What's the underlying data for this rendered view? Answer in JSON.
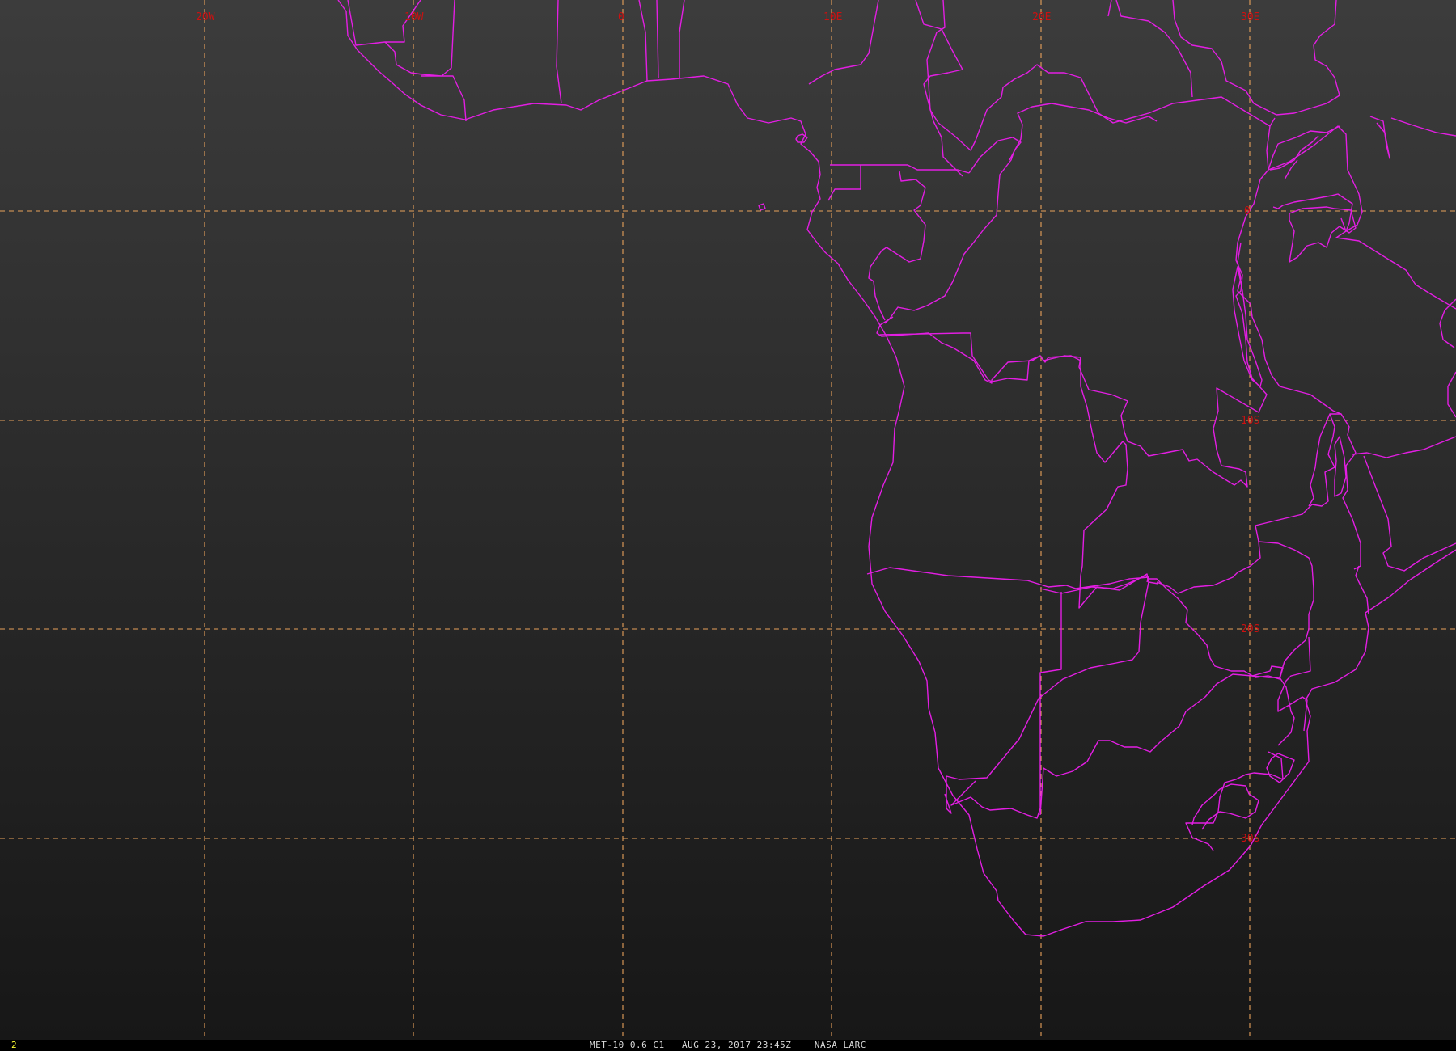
{
  "map": {
    "background_colors": {
      "top": "#3c3c3c",
      "bottom": "#171717"
    },
    "border_color": "#e31ee3",
    "graticule_color": "#e8a15a",
    "label_color": "#cc1111",
    "longitude_labels": [
      "20W",
      "10W",
      "0",
      "10E",
      "20E",
      "30E"
    ],
    "latitude_labels": [
      "0",
      "10S",
      "20S",
      "30S"
    ]
  },
  "status_bar": {
    "frame_number": "2",
    "frame_number_color": "#ffff33",
    "caption": "MET-10 0.6 C1   AUG 23, 2017 23:45Z    NASA LARC"
  }
}
